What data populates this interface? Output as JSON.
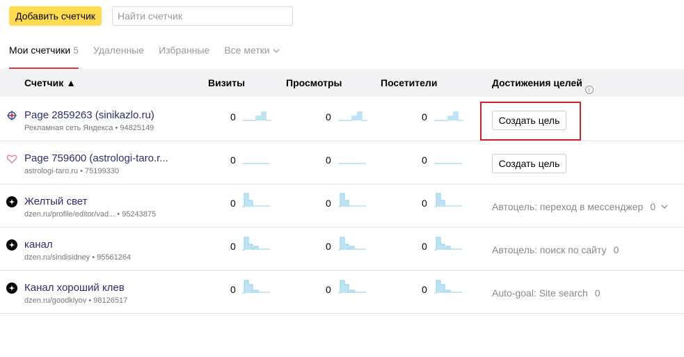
{
  "toolbar": {
    "add_label": "Добавить счетчик",
    "search_placeholder": "Найти счетчик"
  },
  "tabs": [
    {
      "label": "Мои счетчики",
      "count": "5"
    },
    {
      "label": "Удаленные"
    },
    {
      "label": "Избранные"
    },
    {
      "label": "Все метки"
    }
  ],
  "header": {
    "counter": "Счетчик ▲",
    "visits": "Визиты",
    "views": "Просмотры",
    "visitors": "Посетители",
    "goals": "Достижения целей"
  },
  "rows": [
    {
      "icon": "compass-icon",
      "name": "Page 2859263 (sinikazlo.ru)",
      "sub": "Рекламная сеть Яндекса • 94825149",
      "visits": "0",
      "views": "0",
      "visitors": "0",
      "goal_button": "Создать цель",
      "spark": "step-up"
    },
    {
      "icon": "heart-icon",
      "name": "Page 759600 (astrologi-taro.r...",
      "sub": "astrologi-taro.ru • 75199330",
      "visits": "0",
      "views": "0",
      "visitors": "0",
      "goal_button": "Создать цель",
      "spark": "flat"
    },
    {
      "icon": "dzen-icon",
      "name": "Желтый свет",
      "sub": "dzen.ru/profile/editor/vad... • 95243875",
      "visits": "0",
      "views": "0",
      "visitors": "0",
      "goal_text": "Автоцель: переход в мессенджер",
      "goal_value": "0",
      "spark": "spike-a"
    },
    {
      "icon": "dzen-icon",
      "name": "канал",
      "sub": "dzen.ru/sindisidney • 95561264",
      "visits": "0",
      "views": "0",
      "visitors": "0",
      "goal_text": "Автоцель: поиск по сайту",
      "goal_value": "0",
      "spark": "spike-b"
    },
    {
      "icon": "dzen-icon",
      "name": "Канал хороший клев",
      "sub": "dzen.ru/goodklyov • 98126517",
      "visits": "0",
      "views": "0",
      "visitors": "0",
      "goal_text": "Auto-goal: Site search",
      "goal_value": "0",
      "spark": "spike-c"
    }
  ],
  "colors": {
    "accent_yellow": "#ffdb4d",
    "tab_underline": "#e3343b",
    "link": "#2c2c73",
    "spark": "#bde3f5",
    "highlight": "#d0202a"
  }
}
